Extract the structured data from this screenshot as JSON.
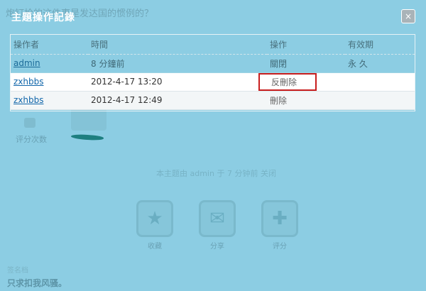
{
  "background": {
    "thread_title": "炮钉枪的这件事是发达国的惯例的？",
    "rating_label": "评分次数",
    "notice": "本主题由 admin 于 7 分钟前 关闭",
    "actions": [
      {
        "label": "收藏",
        "icon": "star-icon"
      },
      {
        "label": "分享",
        "icon": "envelope-icon"
      },
      {
        "label": "评分",
        "icon": "plus-icon"
      }
    ],
    "signature_label": "签名档",
    "signature": "只求扣我风骚。"
  },
  "dialog": {
    "title": "主題操作記錄",
    "close": "×",
    "columns": [
      "操作者",
      "時間",
      "操作",
      "有效期"
    ],
    "rows": [
      {
        "user": "admin",
        "time": "8 分鐘前",
        "action": "關閉",
        "validity": "永 久"
      },
      {
        "user": "zxhbbs",
        "time": "2012-4-17 13:20",
        "action": "反刪除",
        "validity": ""
      },
      {
        "user": "zxhbbs",
        "time": "2012-4-17 12:49",
        "action": "刪除",
        "validity": ""
      }
    ]
  },
  "colors": {
    "overlay": "#8ccde3",
    "highlight_border": "#c81e1e",
    "link": "#1166aa"
  }
}
